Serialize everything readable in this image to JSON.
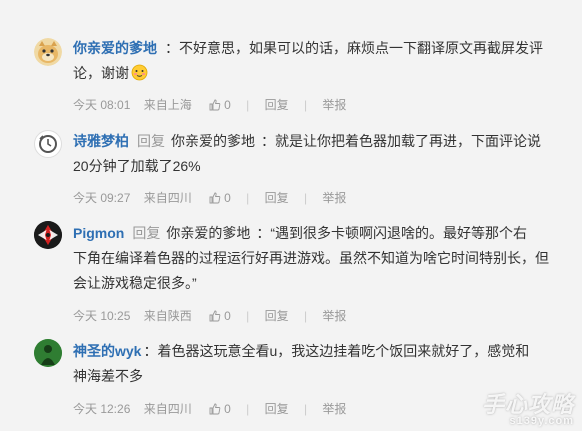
{
  "comments": [
    {
      "username": "你亲爱的爹地",
      "body_line1": "：不好意思，如果可以的话，麻烦点一下翻译原文再截屏发评",
      "body_line2": "论，谢谢",
      "emoji": "blush-emoji",
      "time": "今天 08:01",
      "location": "来自上海",
      "likes": "0",
      "reply": "回复",
      "report": "举报"
    },
    {
      "username": "诗雅梦柏",
      "reply_word": "回复",
      "target": "你亲爱的爹地",
      "body_line1": "：就是让你把着色器加载了再进，下面评论说",
      "body_line2": "20分钟了加载了26%",
      "time": "今天 09:27",
      "location": "来自四川",
      "likes": "0",
      "reply": "回复",
      "report": "举报"
    },
    {
      "username": "Pigmon",
      "reply_word": "回复",
      "target": "你亲爱的爹地",
      "body_line1": "：“遇到很多卡顿啊闪退啥的。最好等那个右",
      "body_line2": "下角在编译着色器的过程运行好再进游戏。虽然不知道为啥它时间特别长，但",
      "body_line3": "会让游戏稳定很多。”",
      "time": "今天 10:25",
      "location": "来自陕西",
      "likes": "0",
      "reply": "回复",
      "report": "举报"
    },
    {
      "username": "神圣的wyk",
      "body_line1": "：着色器这玩意全看u，我这边挂着吃个饭回来就好了，感觉和",
      "body_line2": "神海差不多",
      "time": "今天 12:26",
      "location": "来自四川",
      "likes": "0",
      "reply": "回复",
      "report": "举报"
    }
  ],
  "separator": "|",
  "watermark": {
    "line1": "手心攻略",
    "line2": "s139y.com"
  }
}
